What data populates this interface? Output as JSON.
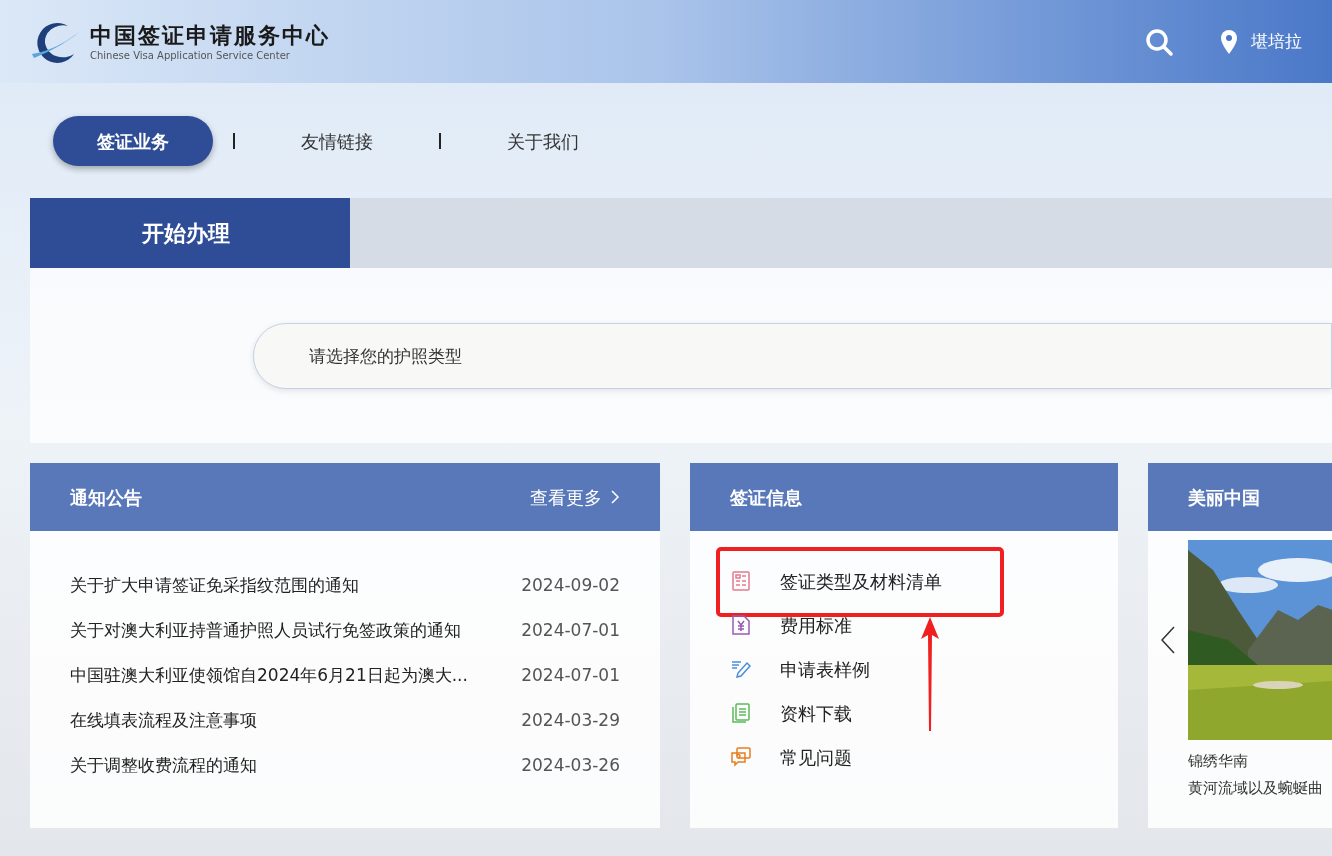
{
  "header": {
    "logo_title": "中国签证申请服务中心",
    "logo_subtitle": "Chinese Visa Application Service Center",
    "location": "堪培拉"
  },
  "nav": [
    {
      "label": "签证业务",
      "selected": true
    },
    {
      "label": "友情链接",
      "selected": false
    },
    {
      "label": "关于我们",
      "selected": false
    }
  ],
  "start": {
    "title": "开始办理",
    "search": {
      "placeholder": "请选择您的护照类型"
    }
  },
  "notices": {
    "title": "通知公告",
    "more": "查看更多",
    "items": [
      {
        "title": "关于扩大申请签证免采指纹范围的通知",
        "date": "2024-09-02"
      },
      {
        "title": "关于对澳大利亚持普通护照人员试行免签政策的通知",
        "date": "2024-07-01"
      },
      {
        "title": "中国驻澳大利亚使领馆自2024年6月21日起为澳大...",
        "date": "2024-07-01"
      },
      {
        "title": "在线填表流程及注意事项",
        "date": "2024-03-29"
      },
      {
        "title": "关于调整收费流程的通知",
        "date": "2024-03-26"
      }
    ]
  },
  "visa_info": {
    "title": "签证信息",
    "items": [
      {
        "label": "签证类型及材料清单",
        "kind": "list",
        "highlighted": true
      },
      {
        "label": "费用标准",
        "kind": "fee",
        "highlighted": false
      },
      {
        "label": "申请表样例",
        "kind": "form",
        "highlighted": false
      },
      {
        "label": "资料下载",
        "kind": "download",
        "highlighted": false
      },
      {
        "label": "常见问题",
        "kind": "faq",
        "highlighted": false
      }
    ]
  },
  "beautiful_china": {
    "title": "美丽中国",
    "slide": {
      "kind": "picture",
      "caption": "锦绣华南",
      "text": "黄河流域以及蜿蜒曲"
    }
  }
}
